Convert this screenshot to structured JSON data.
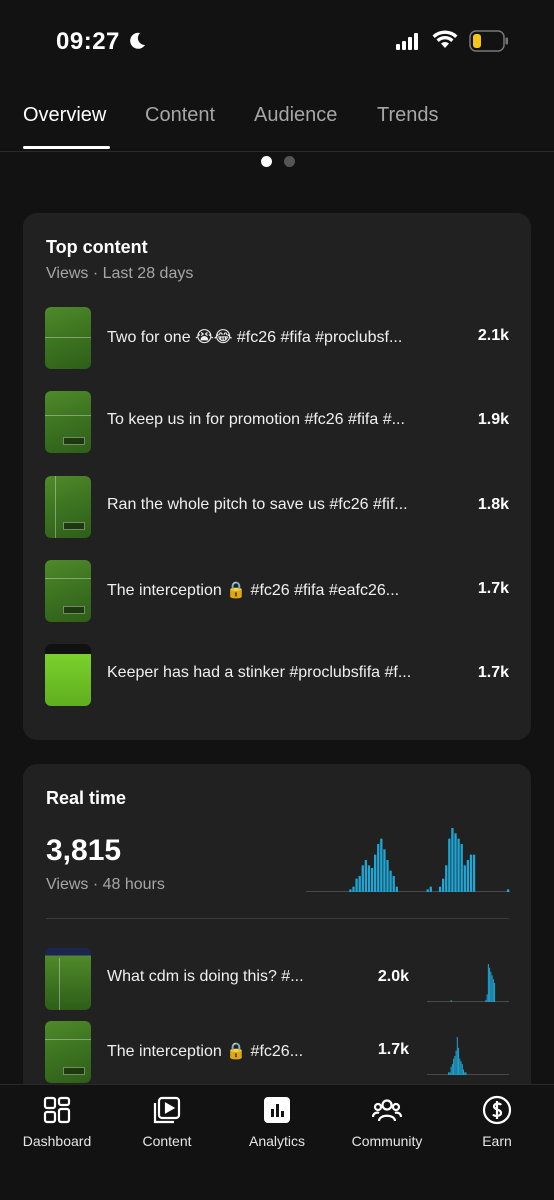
{
  "status_bar": {
    "time": "09:27"
  },
  "tabs": [
    {
      "label": "Overview",
      "active": true
    },
    {
      "label": "Content",
      "active": false
    },
    {
      "label": "Audience",
      "active": false
    },
    {
      "label": "Trends",
      "active": false
    }
  ],
  "pager": {
    "count": 2,
    "active_index": 0
  },
  "top_content": {
    "title": "Top content",
    "subtitle": "Views · Last 28 days",
    "items": [
      {
        "title": "Two for one 😭😂 #fc26 #fifa #proclubsf...",
        "views": "2.1k"
      },
      {
        "title": "To keep us in for promotion #fc26 #fifa #...",
        "views": "1.9k"
      },
      {
        "title": "Ran the whole pitch to save us #fc26 #fif...",
        "views": "1.8k"
      },
      {
        "title": "The interception 🔒 #fc26 #fifa #eafc26...",
        "views": "1.7k"
      },
      {
        "title": "Keeper has had a stinker #proclubsfifa #f...",
        "views": "1.7k"
      }
    ]
  },
  "real_time": {
    "title": "Real time",
    "views_total": "3,815",
    "subtitle": "Views · 48 hours",
    "chart_color": "#1ea7d6",
    "hourly_bars": [
      0,
      0,
      0,
      0,
      0,
      0,
      0,
      0,
      0,
      0,
      0,
      0,
      0,
      0,
      1,
      2,
      5,
      6,
      10,
      12,
      10,
      9,
      14,
      18,
      20,
      16,
      12,
      8,
      6,
      2,
      0,
      0,
      0,
      0,
      0,
      0,
      0,
      0,
      0,
      1,
      2,
      0,
      0,
      2,
      5,
      10,
      20,
      24,
      22,
      20,
      18,
      10,
      12,
      14,
      14,
      0,
      0,
      0,
      0,
      0,
      0,
      0,
      0,
      0,
      0,
      1
    ],
    "items": [
      {
        "title": "What cdm is doing this? #...",
        "views": "2.0k",
        "spark": [
          0,
          0,
          0,
          0,
          0,
          0,
          0,
          0,
          0,
          0,
          0,
          0,
          0,
          0,
          0,
          0,
          0,
          0,
          0,
          1,
          0,
          0,
          0,
          0,
          0,
          0,
          0,
          0,
          0,
          0,
          0,
          0,
          0,
          0,
          0,
          0,
          0,
          0,
          0,
          0,
          0,
          0,
          0,
          0,
          0,
          0,
          0,
          1,
          4,
          20,
          18,
          16,
          14,
          12,
          10,
          0,
          0,
          0,
          0,
          0,
          0,
          0,
          0,
          0,
          0,
          0
        ]
      },
      {
        "title": "The interception 🔒 #fc26...",
        "views": "1.7k",
        "spark": [
          0,
          0,
          0,
          0,
          0,
          0,
          0,
          0,
          0,
          0,
          0,
          0,
          0,
          0,
          0,
          0,
          0,
          1,
          1,
          3,
          4,
          6,
          7,
          9,
          14,
          10,
          6,
          5,
          4,
          2,
          1,
          1,
          0,
          0,
          0,
          0,
          0,
          0,
          0,
          0,
          0,
          0,
          0,
          0,
          0,
          0,
          0,
          0,
          0,
          0,
          0,
          0,
          0,
          0,
          0,
          0,
          0,
          0,
          0,
          0,
          0,
          0,
          0,
          0,
          0,
          0
        ]
      }
    ]
  },
  "bottom_nav": [
    {
      "label": "Dashboard",
      "icon": "dashboard-icon"
    },
    {
      "label": "Content",
      "icon": "content-icon"
    },
    {
      "label": "Analytics",
      "icon": "analytics-icon",
      "active": true
    },
    {
      "label": "Community",
      "icon": "community-icon"
    },
    {
      "label": "Earn",
      "icon": "earn-icon"
    }
  ]
}
